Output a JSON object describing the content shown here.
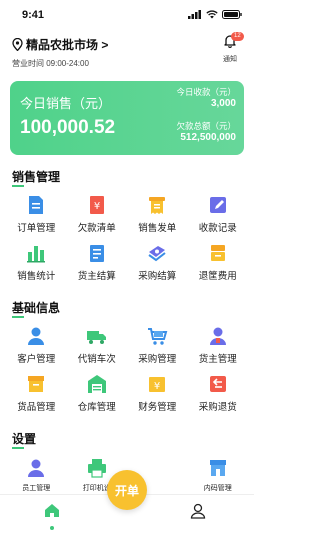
{
  "status_bar": {
    "time": "9:41"
  },
  "header": {
    "market_name": "精品农批市场 >",
    "hours": "营业时间  09:00-24:00",
    "notification": {
      "label": "通知",
      "badge": "12"
    }
  },
  "sales_card": {
    "title": "今日销售（元）",
    "amount": "100,000.52",
    "today_received_label": "今日收款（元）",
    "today_received_value": "3,000",
    "debt_total_label": "欠款总额（元）",
    "debt_total_value": "512,500,000"
  },
  "sales_management": {
    "title": "销售管理",
    "items": [
      {
        "label": "订单管理",
        "icon": "document-icon"
      },
      {
        "label": "欠款清单",
        "icon": "yen-ledger-icon"
      },
      {
        "label": "销售发单",
        "icon": "receipt-icon"
      },
      {
        "label": "收款记录",
        "icon": "edit-record-icon"
      },
      {
        "label": "销售统计",
        "icon": "bar-chart-icon"
      },
      {
        "label": "货主结算",
        "icon": "owner-settle-icon"
      },
      {
        "label": "采购结算",
        "icon": "purchase-settle-icon"
      },
      {
        "label": "退筐费用",
        "icon": "basket-refund-icon"
      }
    ]
  },
  "basic_info": {
    "title": "基础信息",
    "items": [
      {
        "label": "客户管理",
        "icon": "customer-icon"
      },
      {
        "label": "代销车次",
        "icon": "truck-icon"
      },
      {
        "label": "采购管理",
        "icon": "cart-icon"
      },
      {
        "label": "货主管理",
        "icon": "owner-icon"
      },
      {
        "label": "货品管理",
        "icon": "goods-icon"
      },
      {
        "label": "仓库管理",
        "icon": "warehouse-icon"
      },
      {
        "label": "财务管理",
        "icon": "finance-icon"
      },
      {
        "label": "采购退货",
        "icon": "return-icon"
      }
    ]
  },
  "settings": {
    "title": "设置",
    "items": [
      {
        "label": "员工管理",
        "icon": "staff-icon"
      },
      {
        "label": "打印机设",
        "icon": "printer-icon"
      },
      {
        "label": "",
        "icon": "hidden"
      },
      {
        "label": "内码管理",
        "icon": "store-icon"
      }
    ]
  },
  "fab": {
    "label": "开单"
  },
  "colors": {
    "brand_green": "#3ec77a",
    "card_green": "#55d38e",
    "fab_yellow": "#f8c12f"
  }
}
